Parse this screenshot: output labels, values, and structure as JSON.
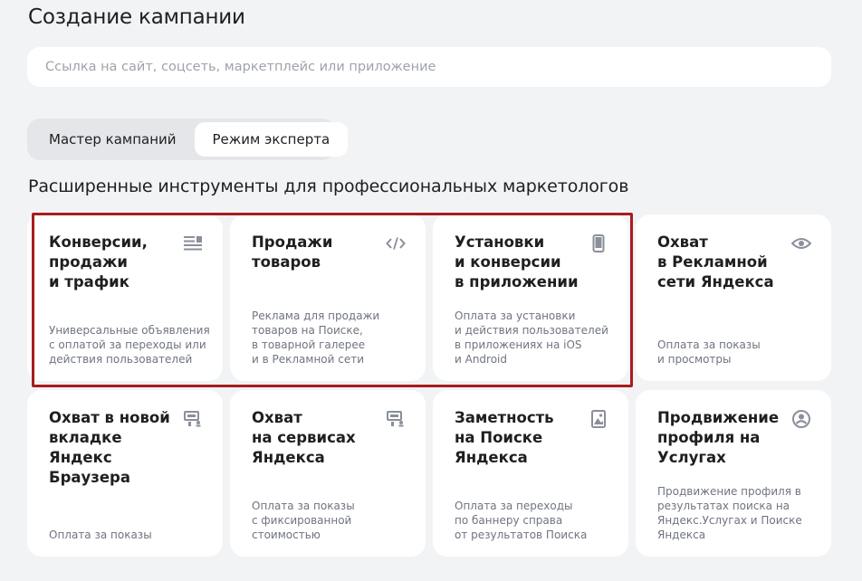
{
  "header": {
    "title": "Создание кампании"
  },
  "url_input": {
    "placeholder": "Ссылка на сайт, соцсеть, маркетплейс или приложение",
    "value": ""
  },
  "mode_switch": {
    "tabs": [
      {
        "label": "Мастер кампаний",
        "active": false
      },
      {
        "label": "Режим эксперта",
        "active": true
      }
    ]
  },
  "section": {
    "title": "Расширенные инструменты для профессиональных маркетологов"
  },
  "cards": [
    {
      "title": "Конверсии,\nпродажи\nи трафик",
      "description": "Универсальные объявления\nс оплатой за переходы или\nдействия пользователей",
      "icon": "text-ad-icon",
      "highlighted": true
    },
    {
      "title": "Продажи\nтоваров",
      "description": "Реклама для продажи\nтоваров на Поиске,\nв товарной галерее\nи в Рекламной сети",
      "icon": "code-icon",
      "highlighted": true
    },
    {
      "title": "Установки\nи конверсии\nв приложении",
      "description": "Оплата за установки\nи действия пользователей\nв приложениях на iOS\nи Android",
      "icon": "smartphone-icon",
      "highlighted": true
    },
    {
      "title": "Охват\nв Рекламной\nсети Яндекса",
      "description": "Оплата за показы\nи просмотры",
      "icon": "eye-icon",
      "highlighted": false
    },
    {
      "title": "Охват в новой\nвкладке Яндекс\nБраузера",
      "description": "Оплата за показы",
      "icon": "banner-person-icon",
      "highlighted": false
    },
    {
      "title": "Охват\nна сервисах\nЯндекса",
      "description": "Оплата за показы\nс фиксированной\nстоимостью",
      "icon": "banner-person-icon",
      "highlighted": false
    },
    {
      "title": "Заметность\nна Поиске\nЯндекса",
      "description": "Оплата за переходы\nпо баннеру справа\nот результатов Поиска",
      "icon": "image-icon",
      "highlighted": false
    },
    {
      "title": "Продвижение\nпрофиля на\nУслугах",
      "description": "Продвижение профиля в\nрезультатах поиска на\nЯндекс.Услугах и Поиске\nЯндекса",
      "icon": "services-profile-icon",
      "highlighted": false
    }
  ],
  "colors": {
    "background": "#f2f3f5",
    "card": "#ffffff",
    "icon": "#8a8f99",
    "highlight_border": "#a81c1c",
    "description_text": "#6f7480"
  }
}
